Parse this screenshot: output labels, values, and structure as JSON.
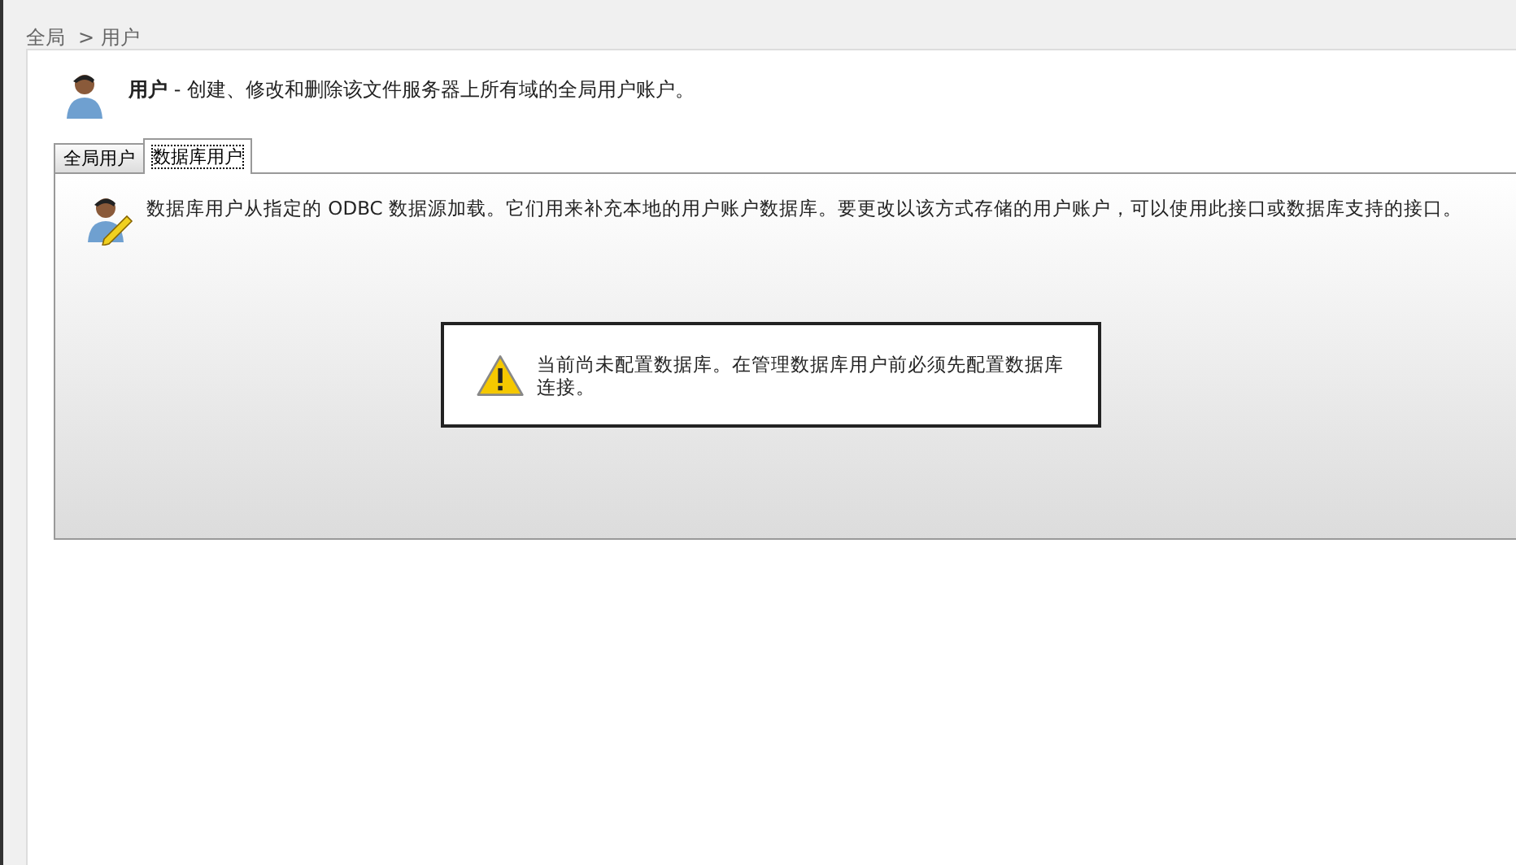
{
  "breadcrumb": [
    {
      "label": "全局"
    },
    {
      "label": "> 用户"
    }
  ],
  "header": {
    "text": "**用户** - 创建、修改和删除该文件服务器上所有域的全局用户账户。"
  },
  "tabs": [
    {
      "label": "全局用户",
      "selected": false
    },
    {
      "label": "数据库用户",
      "selected": true
    }
  ],
  "description": "数据库用户从指定的 ODBC 数据源加载。它们用来补充本地的用户账户数据库。要更改以该方式存储的用户账户，可以使用此接口或数据库支持的接口。",
  "warning": "当前尚未配置数据库。在管理数据库用户前必须先配置数据库连接。"
}
